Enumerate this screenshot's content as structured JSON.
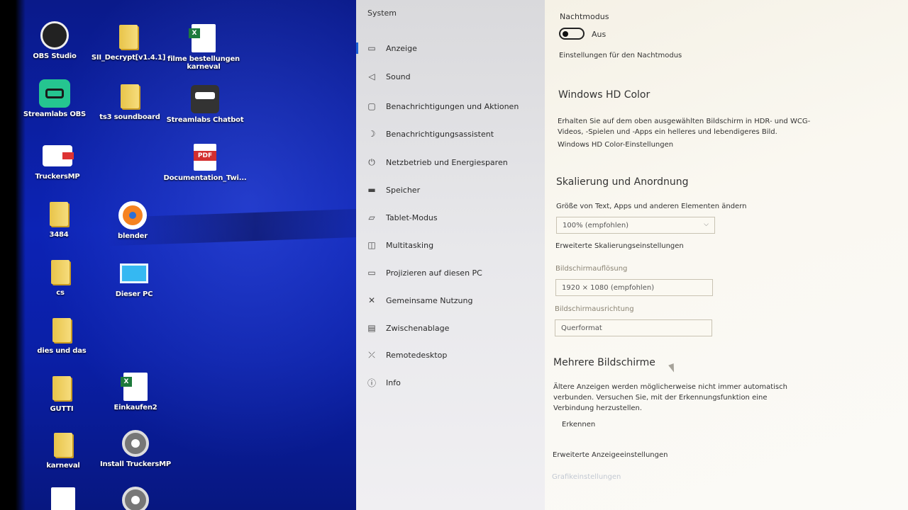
{
  "desktop": {
    "icons": [
      {
        "label": "OBS Studio",
        "icon": "obs-icon"
      },
      {
        "label": "SII_Decrypt[v1.4.1]",
        "icon": "folder-icon"
      },
      {
        "label": "filme bestellungen karneval",
        "icon": "excel-file-icon"
      },
      {
        "label": "Streamlabs OBS",
        "icon": "streamlabs-obs-icon"
      },
      {
        "label": "ts3 soundboard",
        "icon": "folder-icon"
      },
      {
        "label": "Streamlabs Chatbot",
        "icon": "streamlabs-chatbot-icon"
      },
      {
        "label": "TruckersMP",
        "icon": "truckersmp-icon"
      },
      {
        "label": "Documentation_Twi...",
        "icon": "pdf-file-icon"
      },
      {
        "label": "3484",
        "icon": "folder-icon"
      },
      {
        "label": "blender",
        "icon": "blender-icon"
      },
      {
        "label": "cs",
        "icon": "folder-icon"
      },
      {
        "label": "Dieser PC",
        "icon": "this-pc-icon"
      },
      {
        "label": "dies und das",
        "icon": "folder-icon"
      },
      {
        "label": "GUTTI",
        "icon": "folder-icon"
      },
      {
        "label": "Einkaufen2",
        "icon": "excel-file-icon"
      },
      {
        "label": "karneval",
        "icon": "folder-icon"
      },
      {
        "label": "Install TruckersMP",
        "icon": "installer-icon"
      }
    ]
  },
  "nav": {
    "title": "System",
    "items": [
      {
        "label": "Anzeige",
        "icon": "monitor-icon",
        "glyph": "▭"
      },
      {
        "label": "Sound",
        "icon": "speaker-icon",
        "glyph": "◁"
      },
      {
        "label": "Benachrichtigungen und Aktionen",
        "icon": "notification-icon",
        "glyph": "▢"
      },
      {
        "label": "Benachrichtigungsassistent",
        "icon": "moon-icon",
        "glyph": "☽"
      },
      {
        "label": "Netzbetrieb und Energiesparen",
        "icon": "power-icon",
        "glyph": "⏻"
      },
      {
        "label": "Speicher",
        "icon": "storage-icon",
        "glyph": "▬"
      },
      {
        "label": "Tablet-Modus",
        "icon": "tablet-icon",
        "glyph": "▱"
      },
      {
        "label": "Multitasking",
        "icon": "multitasking-icon",
        "glyph": "◫"
      },
      {
        "label": "Projizieren auf diesen PC",
        "icon": "project-icon",
        "glyph": "▭"
      },
      {
        "label": "Gemeinsame Nutzung",
        "icon": "share-icon",
        "glyph": "✕"
      },
      {
        "label": "Zwischenablage",
        "icon": "clipboard-icon",
        "glyph": "▤"
      },
      {
        "label": "Remotedesktop",
        "icon": "remote-desktop-icon",
        "glyph": "⤫"
      },
      {
        "label": "Info",
        "icon": "info-icon",
        "glyph": "ⓘ"
      }
    ]
  },
  "content": {
    "night_mode": {
      "label": "Nachtmodus",
      "state": "Aus",
      "link": "Einstellungen für den Nachtmodus"
    },
    "hd_color": {
      "heading": "Windows HD Color",
      "description": "Erhalten Sie auf dem oben ausgewählten Bildschirm in HDR- und WCG-Videos, -Spielen und -Apps ein helleres und lebendigeres Bild.",
      "link": "Windows HD Color-Einstellungen"
    },
    "scaling": {
      "heading": "Skalierung und Anordnung",
      "size_label": "Größe von Text, Apps und anderen Elementen ändern",
      "size_value": "100% (empfohlen)",
      "advanced_link": "Erweiterte Skalierungseinstellungen",
      "resolution_label": "Bildschirmauflösung",
      "resolution_value": "1920 × 1080 (empfohlen)",
      "orientation_label": "Bildschirmausrichtung",
      "orientation_value": "Querformat"
    },
    "multi": {
      "heading": "Mehrere Bildschirme",
      "description": "Ältere Anzeigen werden möglicherweise nicht immer automatisch verbunden. Versuchen Sie, mit der Erkennungsfunktion eine Verbindung herzustellen.",
      "detect_button": "Erkennen",
      "advanced_display_link": "Erweiterte Anzeigeeinstellungen",
      "graphics_link": "Grafikeinstellungen"
    }
  }
}
